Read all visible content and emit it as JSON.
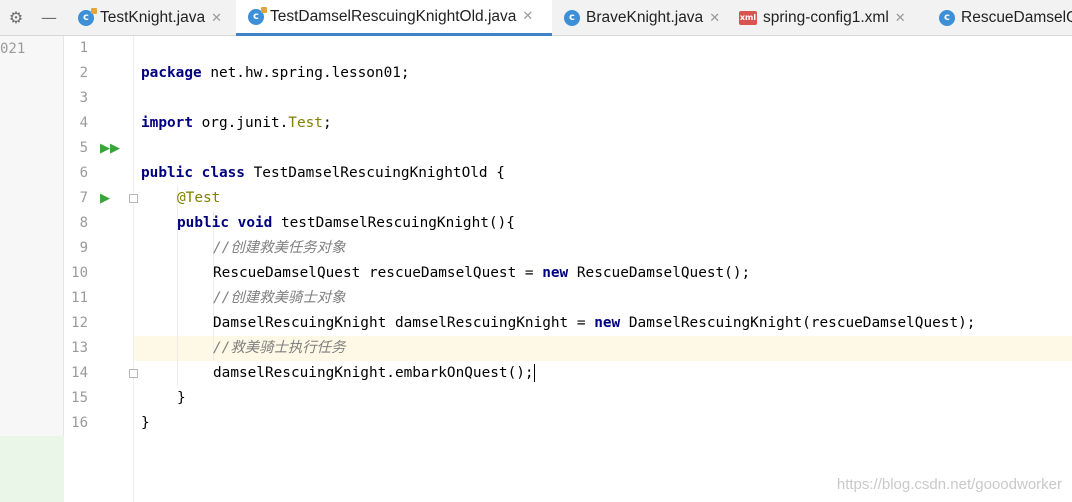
{
  "toolbar": {
    "settings_icon": "gear-icon",
    "minimize_icon": "minus-icon"
  },
  "tabs": [
    {
      "label": "TestKnight.java",
      "icon": "class-c",
      "close": "✕"
    },
    {
      "label": "TestDamselRescuingKnightOld.java",
      "icon": "class-c",
      "close": "✕",
      "active": true
    },
    {
      "label": "BraveKnight.java",
      "icon": "class-c",
      "close": "✕"
    },
    {
      "label": "spring-config1.xml",
      "icon": "xml-file",
      "close": "✕"
    },
    {
      "label": "RescueDamselQ",
      "icon": "class-c"
    }
  ],
  "left_fragment": "021",
  "editor": {
    "lines": [
      {
        "n": "1"
      },
      {
        "n": "2"
      },
      {
        "n": "3"
      },
      {
        "n": "4"
      },
      {
        "n": "5"
      },
      {
        "n": "6"
      },
      {
        "n": "7"
      },
      {
        "n": "8"
      },
      {
        "n": "9"
      },
      {
        "n": "10"
      },
      {
        "n": "11"
      },
      {
        "n": "12"
      },
      {
        "n": "13"
      },
      {
        "n": "14"
      },
      {
        "n": "15"
      },
      {
        "n": "16"
      }
    ],
    "code": {
      "l1_kw": "package",
      "l1_rest": " net.hw.spring.lesson01;",
      "l3_kw": "import",
      "l3_pre": " org.junit.",
      "l3_cls": "Test",
      "l3_end": ";",
      "l5_kw1": "public",
      "l5_kw2": "class",
      "l5_rest": " TestDamselRescuingKnightOld {",
      "l6_ann": "@Test",
      "l7_kw1": "public",
      "l7_kw2": "void",
      "l7_rest": " testDamselRescuingKnight(){",
      "l8_cm": "//创建救美任务对象",
      "l9_a": "RescueDamselQuest rescueDamselQuest = ",
      "l9_kw": "new",
      "l9_b": " RescueDamselQuest();",
      "l10_cm": "//创建救美骑士对象",
      "l11_a": "DamselRescuingKnight damselRescuingKnight = ",
      "l11_kw": "new",
      "l11_b": " DamselRescuingKnight(rescueDamselQuest);",
      "l12_cm": "//救美骑士执行任务",
      "l13": "damselRescuingKnight.embarkOnQuest();",
      "l14": "}",
      "l15": "}"
    },
    "current_line": "13"
  },
  "watermark": "https://blog.csdn.net/gooodworker",
  "colors": {
    "keyword": "#000080",
    "annotation": "#808000",
    "comment": "#808080",
    "run_icon": "#3ba33b",
    "active_tab_underline": "#4083c9"
  }
}
